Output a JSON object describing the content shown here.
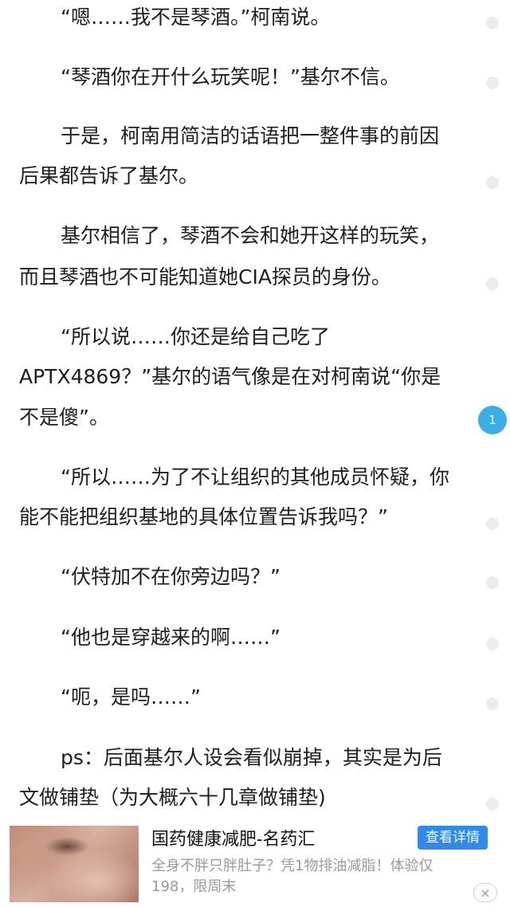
{
  "content": {
    "lines": [
      "“嗯……我不是琴酒。”柯南说。",
      "“琴酒你在开什么玩笑呢！”基尔不信。",
      "于是，柯南用简洁的话语把一整件事的前因",
      "后果都告诉了基尔。",
      "基尔相信了，琴酒不会和她开这样的玩笑，",
      "而且琴酒也不可能知道她CIA探员的身份。",
      "“所以说……你还是给自己吃了",
      "APTX4869？”基尔的语气像是在对柯南说“你是",
      "不是傻”。",
      "“所以……为了不让组织的其他成员怀疑，你",
      "能不能把组织基地的具体位置告诉我吗？”",
      "“伏特加不在你旁边吗？”",
      "“他也是穿越来的啊……”",
      "“呃，是吗……”",
      "ps：后面基尔人设会看似崩掉，其实是为后",
      "文做铺垫（为大概六十几章做铺垫)"
    ]
  },
  "paragraph_comments": {
    "count_badge": "1"
  },
  "ad": {
    "title": "国药健康减肥-名药汇",
    "button_label": "查看详情",
    "desc_line1": "全身不胖只胖肚子？凭1物排油减脂！体验仅",
    "desc_line2": "198，限周末",
    "close_icon": "×"
  },
  "colors": {
    "accent": "#3aaee6",
    "ad_button": "#2f8ae8",
    "text": "#1e1e1e",
    "muted": "#9a9a9a"
  }
}
